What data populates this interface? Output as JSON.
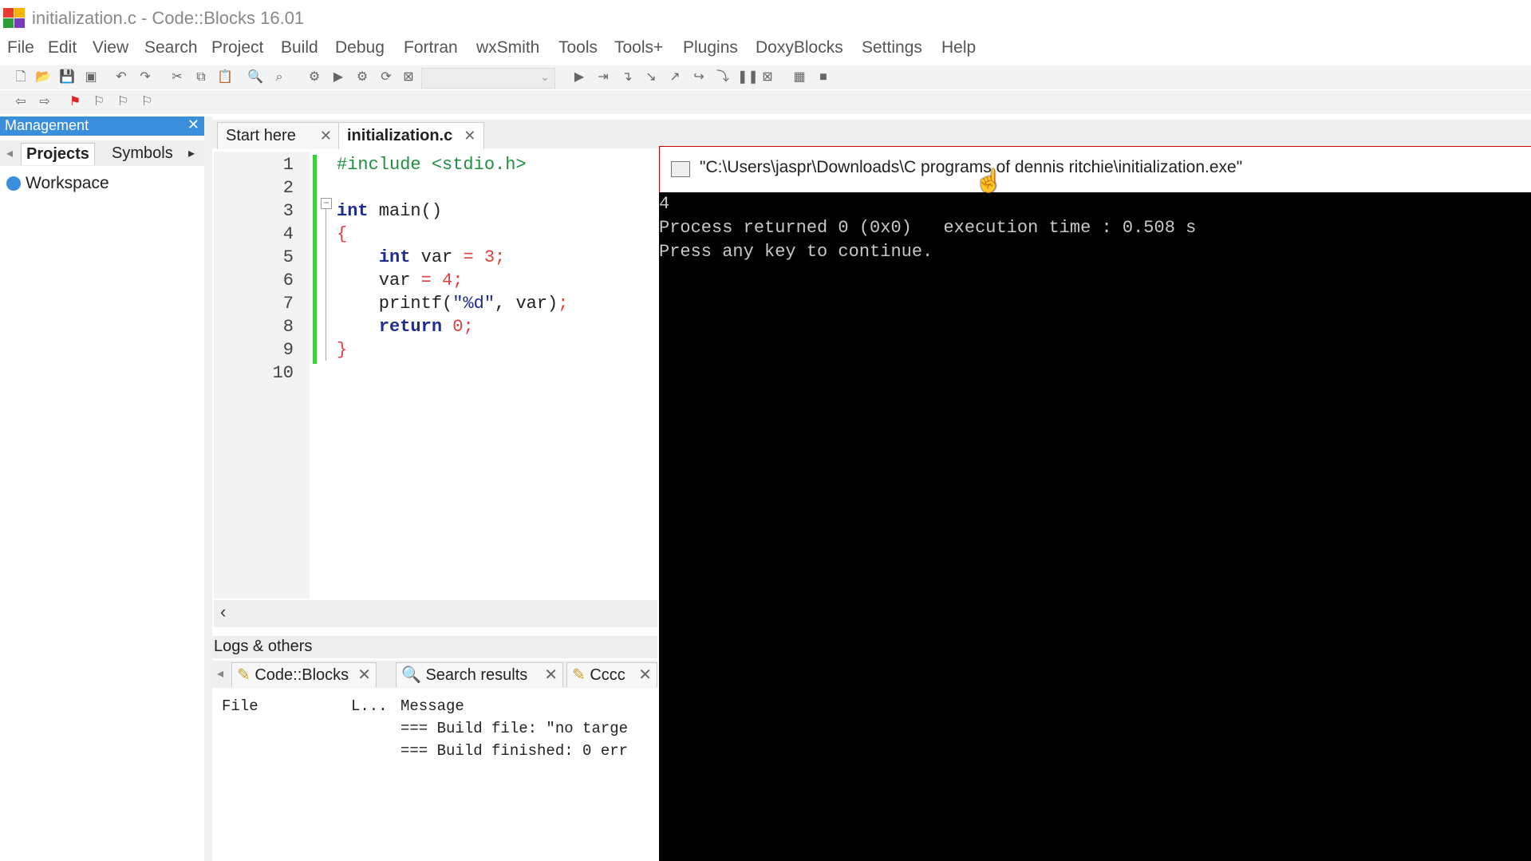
{
  "window": {
    "title": "initialization.c - Code::Blocks 16.01"
  },
  "menu": [
    "File",
    "Edit",
    "View",
    "Search",
    "Project",
    "Build",
    "Debug",
    "Fortran",
    "wxSmith",
    "Tools",
    "Tools+",
    "Plugins",
    "DoxyBlocks",
    "Settings",
    "Help"
  ],
  "management": {
    "title": "Management",
    "tabs": [
      "Projects",
      "Symbols"
    ],
    "workspace": "Workspace"
  },
  "editor": {
    "tabs": [
      {
        "label": "Start here"
      },
      {
        "label": "initialization.c"
      }
    ],
    "line_numbers": [
      "1",
      "2",
      "3",
      "4",
      "5",
      "6",
      "7",
      "8",
      "9",
      "10"
    ]
  },
  "logs": {
    "title": "Logs & others",
    "tabs": [
      "Code::Blocks",
      "Search results",
      "Cccc"
    ],
    "columns": [
      "File",
      "L...",
      "Message"
    ],
    "rows": [
      "=== Build file: \"no targe",
      "=== Build finished: 0 err"
    ]
  },
  "console": {
    "title": "\"C:\\Users\\jaspr\\Downloads\\C programs of dennis ritchie\\initialization.exe\"",
    "lines": [
      "4",
      "Process returned 0 (0x0)   execution time : 0.508 s",
      "Press any key to continue."
    ]
  },
  "colors": {
    "management_header": "#3a8fdc",
    "change_bar": "#3ed03e",
    "keyword": "#1e2b8f",
    "preprocessor": "#1f8f3f",
    "number": "#e04040"
  }
}
